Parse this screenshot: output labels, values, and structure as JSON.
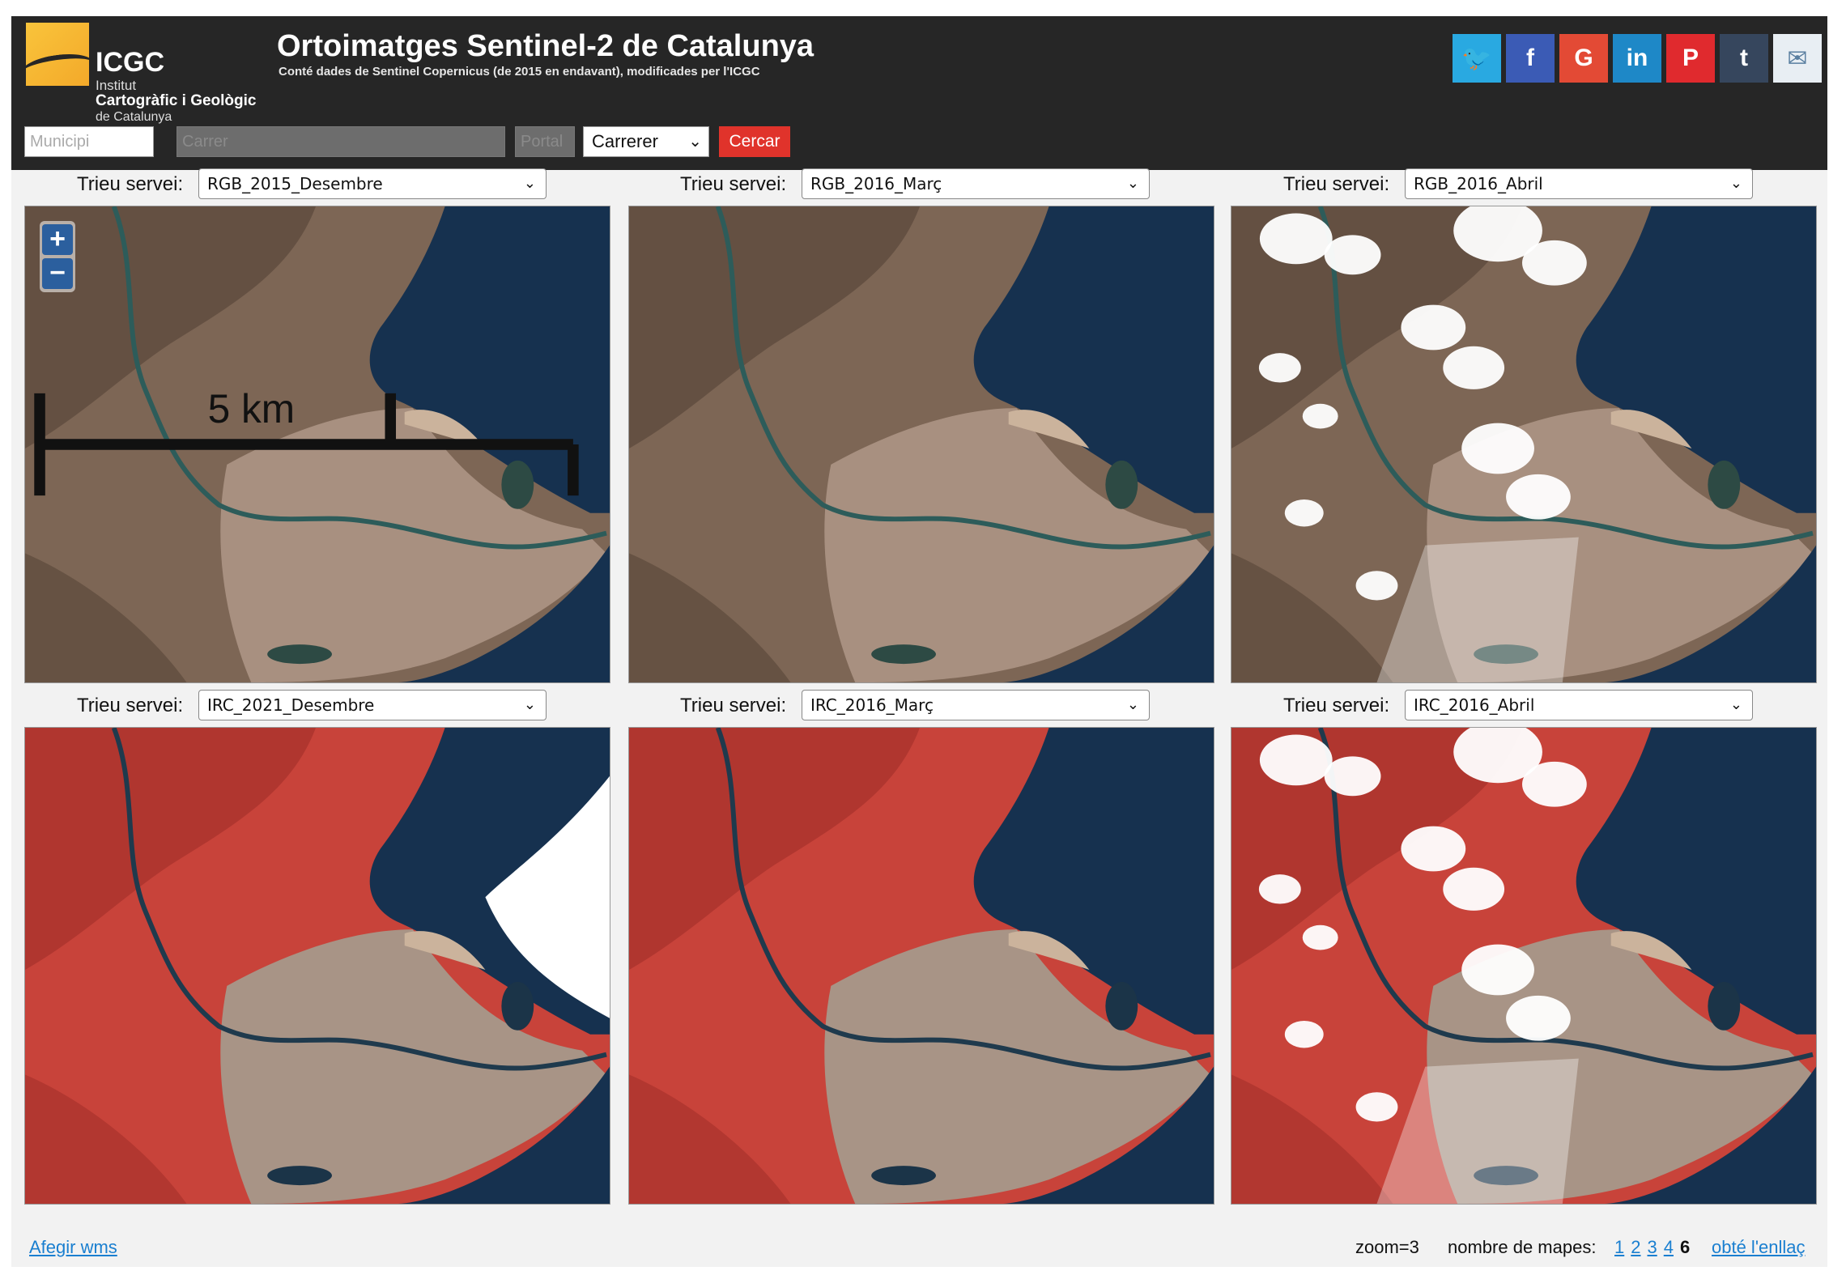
{
  "header": {
    "logo": {
      "acronym": "ICGC",
      "line1": "Institut",
      "line2": "Cartogràfic i Geològic",
      "line3": "de Catalunya"
    },
    "title": "Ortoimatges Sentinel-2 de Catalunya",
    "subtitle": "Conté dades de Sentinel Copernicus (de 2015 en endavant), modificades per l'ICGC",
    "social": [
      {
        "name": "twitter",
        "glyph": "🐦",
        "color": "#29a9e1"
      },
      {
        "name": "facebook",
        "glyph": "f",
        "color": "#3b5bb5"
      },
      {
        "name": "google-plus",
        "glyph": "G",
        "color": "#e34a35"
      },
      {
        "name": "linkedin",
        "glyph": "in",
        "color": "#1e88c7"
      },
      {
        "name": "pinterest",
        "glyph": "P",
        "color": "#e02a2e"
      },
      {
        "name": "tumblr",
        "glyph": "t",
        "color": "#36465d"
      },
      {
        "name": "email",
        "glyph": "✉",
        "color": "#e8eef3"
      }
    ]
  },
  "search": {
    "municipality_placeholder": "Municipi",
    "street_placeholder": "Carrer",
    "portal_placeholder": "Portal",
    "type_selected": "Carrerer",
    "search_button": "Cercar"
  },
  "panels": [
    {
      "label": "Trieu servei:",
      "service": "RGB_2015_Desembre",
      "kind": "rgb",
      "clouds": false
    },
    {
      "label": "Trieu servei:",
      "service": "RGB_2016_Març",
      "kind": "rgb",
      "clouds": false
    },
    {
      "label": "Trieu servei:",
      "service": "RGB_2016_Abril",
      "kind": "rgb",
      "clouds": true
    },
    {
      "label": "Trieu servei:",
      "service": "IRC_2021_Desembre",
      "kind": "irc",
      "clouds": false
    },
    {
      "label": "Trieu servei:",
      "service": "IRC_2016_Març",
      "kind": "irc",
      "clouds": false
    },
    {
      "label": "Trieu servei:",
      "service": "IRC_2016_Abril",
      "kind": "irc",
      "clouds": true
    }
  ],
  "map_controls": {
    "zoom_in": "+",
    "zoom_out": "−",
    "scale_label": "5 km"
  },
  "footer": {
    "add_wms": "Afegir wms",
    "zoom": "zoom=3",
    "map_count_label": "nombre de mapes:",
    "map_counts": [
      "1",
      "2",
      "3",
      "4"
    ],
    "current_count": "6",
    "get_link": "obté l'enllaç"
  },
  "colors": {
    "header_bg": "#262626",
    "accent_red": "#e0332b",
    "link_blue": "#1a7fd0",
    "rgb_land": "#7d6655",
    "rgb_delta": "#a89080",
    "sea": "#16314f",
    "irc_land": "#c8433a",
    "irc_delta": "#a89486"
  }
}
